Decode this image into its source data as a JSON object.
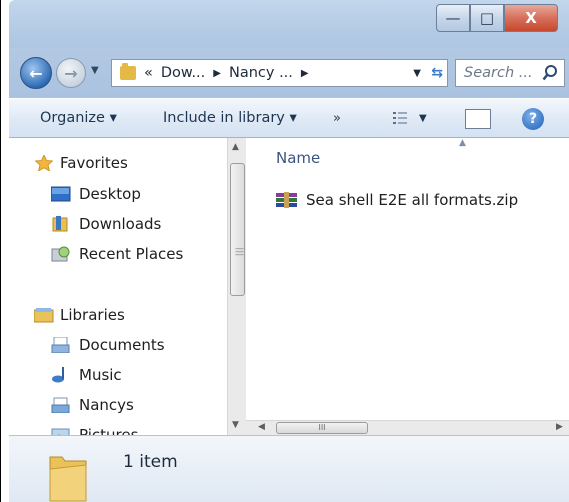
{
  "window": {
    "controls": {
      "minimize": "—",
      "maximize": "□",
      "close": "X"
    }
  },
  "addressbar": {
    "overflow": "«",
    "segments": [
      "Dow...",
      "Nancy ..."
    ],
    "search_placeholder": "Search ..."
  },
  "commandbar": {
    "organize": "Organize ▾",
    "include": "Include in library ▾",
    "more": "»",
    "help": "?"
  },
  "navpane": {
    "favorites": "Favorites",
    "desktop": "Desktop",
    "downloads": "Downloads",
    "recent": "Recent Places",
    "libraries": "Libraries",
    "documents": "Documents",
    "music": "Music",
    "nancys": "Nancys",
    "pictures": "Pictures"
  },
  "content": {
    "column_name": "Name",
    "files": [
      {
        "name": "Sea shell E2E all formats.zip",
        "icon": "winrar-archive-icon"
      }
    ],
    "hscroll_grip": "III"
  },
  "details": {
    "item_count": "1 item"
  }
}
